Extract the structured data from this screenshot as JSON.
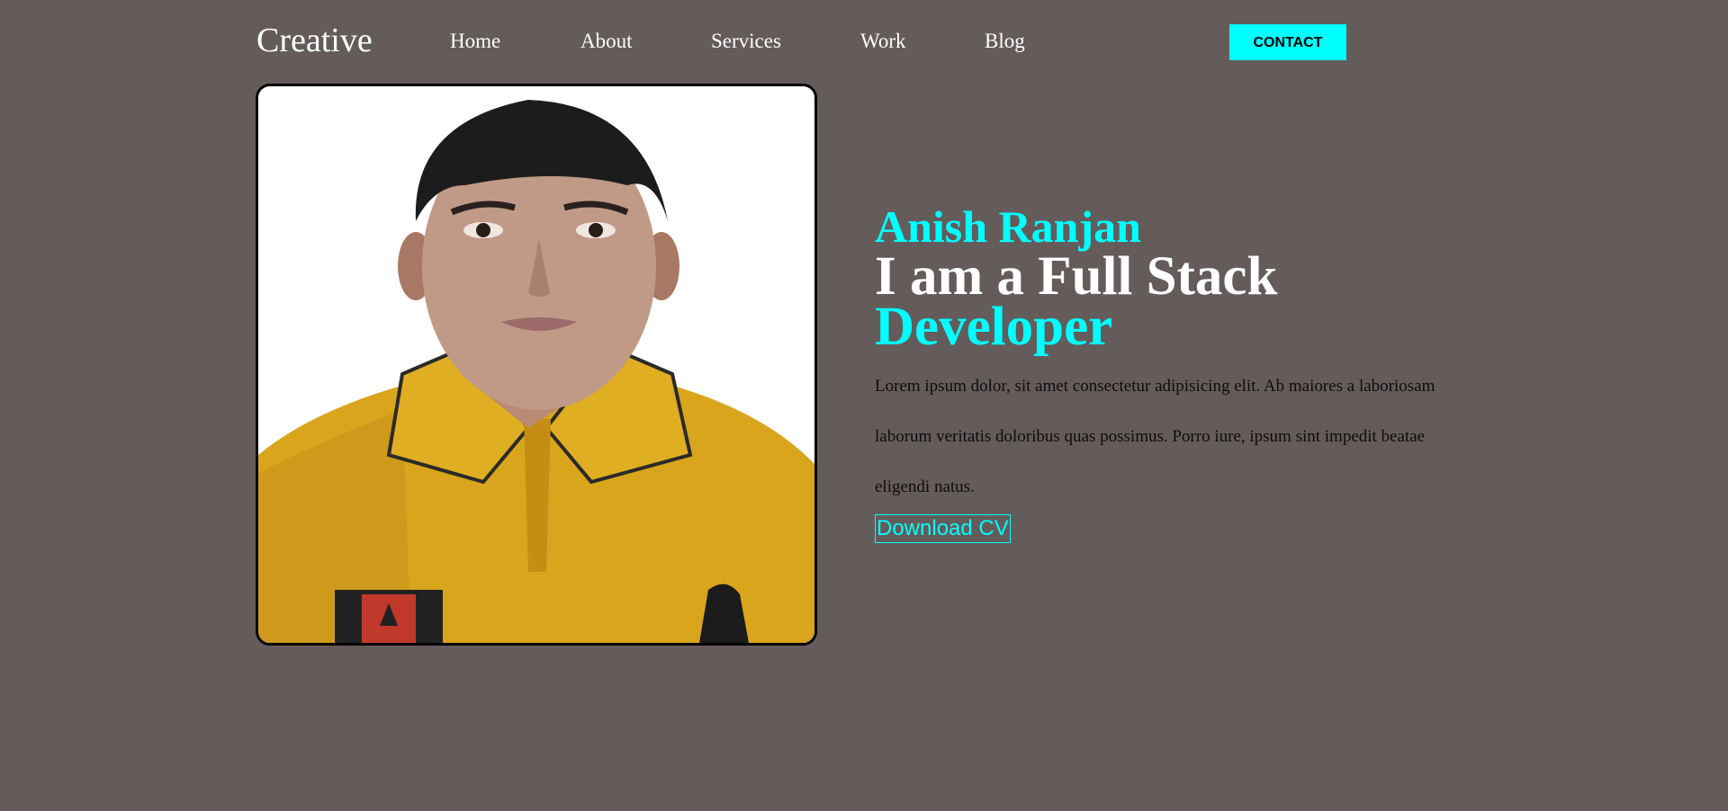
{
  "brand": {
    "logo_text": "Creative"
  },
  "nav": {
    "items": [
      {
        "label": "Home"
      },
      {
        "label": "About"
      },
      {
        "label": "Services"
      },
      {
        "label": "Work"
      },
      {
        "label": "Blog"
      }
    ],
    "contact_label": "CONTACT"
  },
  "hero": {
    "name": "Anish Ranjan",
    "title_line1": "I am a Full Stack",
    "title_line2": "Developer",
    "description": "Lorem ipsum dolor, sit amet consectetur adipisicing elit. Ab maiores a laboriosam laborum veritatis doloribus quas possimus. Porro iure, ipsum sint impedit beatae eligendi natus.",
    "download_label": "Download CV",
    "photo_icon": "profile-photo"
  },
  "colors": {
    "background": "#645c5b",
    "accent": "#00ffff",
    "text": "#ffffff"
  }
}
